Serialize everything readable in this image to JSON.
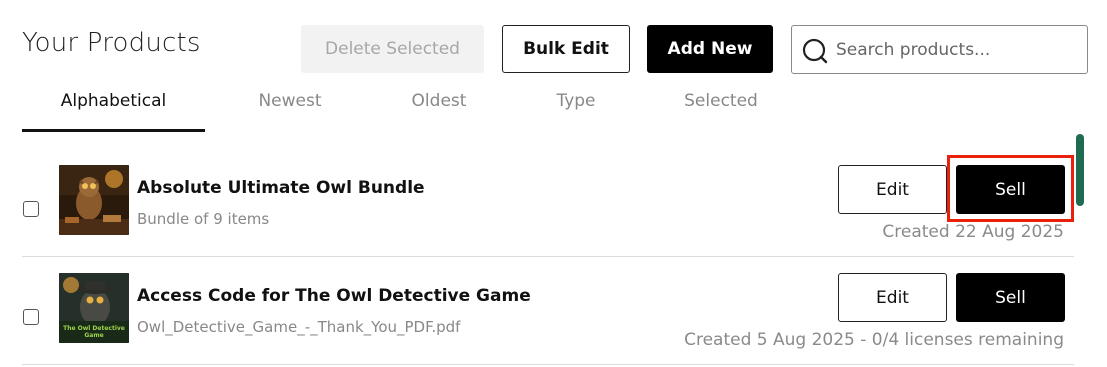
{
  "header": {
    "title": "Your Products",
    "delete_selected": "Delete Selected",
    "bulk_edit": "Bulk Edit",
    "add_new": "Add New"
  },
  "search": {
    "placeholder": "Search products..."
  },
  "tabs": [
    {
      "label": "Alphabetical",
      "active": true
    },
    {
      "label": "Newest",
      "active": false
    },
    {
      "label": "Oldest",
      "active": false
    },
    {
      "label": "Type",
      "active": false
    },
    {
      "label": "Selected",
      "active": false
    }
  ],
  "products": [
    {
      "name": "Absolute Ultimate Owl Bundle",
      "subtitle": "Bundle of 9 items",
      "meta": "Created 22 Aug 2025",
      "edit_label": "Edit",
      "sell_label": "Sell"
    },
    {
      "name": "Access Code for The Owl Detective Game",
      "subtitle": "Owl_Detective_Game_-_Thank_You_PDF.pdf",
      "meta": "Created 5 Aug 2025 - 0/4 licenses remaining",
      "edit_label": "Edit",
      "sell_label": "Sell",
      "thumb_caption": "The Owl Detective Game"
    }
  ],
  "colors": {
    "accent_black": "#000000",
    "disabled_bg": "#f2f2f2",
    "highlight_red": "#e8210c",
    "scrollbar_green": "#1e6b52"
  }
}
